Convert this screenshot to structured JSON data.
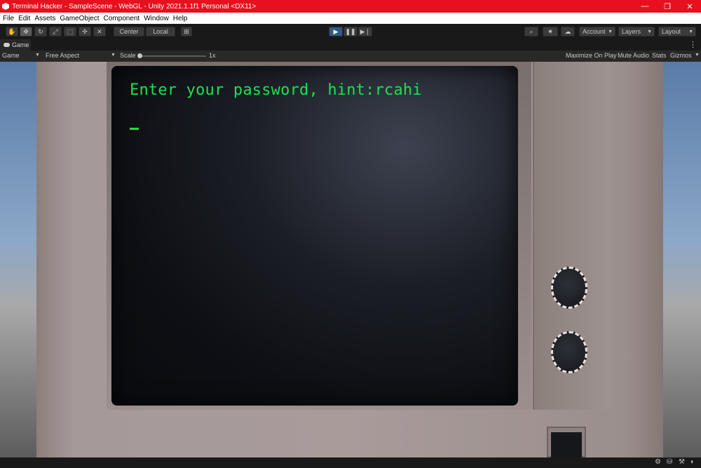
{
  "window": {
    "title": "Terminal Hacker - SampleScene - WebGL - Unity 2021.1.1f1 Personal <DX11>",
    "controls": {
      "minimize": "—",
      "restore": "❐",
      "close": "✕"
    }
  },
  "menu": [
    "File",
    "Edit",
    "Assets",
    "GameObject",
    "Component",
    "Window",
    "Help"
  ],
  "toolbar": {
    "tools": [
      {
        "name": "hand-tool",
        "glyph": "✋"
      },
      {
        "name": "move-tool",
        "glyph": "✥"
      },
      {
        "name": "rotate-tool",
        "glyph": "↻"
      },
      {
        "name": "scale-tool",
        "glyph": "⤢"
      },
      {
        "name": "rect-tool",
        "glyph": "⬚"
      },
      {
        "name": "transform-tool",
        "glyph": "✣"
      },
      {
        "name": "custom-tool",
        "glyph": "✕"
      }
    ],
    "pivot_label": "Center",
    "space_label": "Local",
    "snap_glyph": "⊞",
    "play_glyph": "▶",
    "pause_glyph": "❚❚",
    "step_glyph": "▶❘",
    "search_glyph": "⌕",
    "services_glyph": "✷",
    "cloud_glyph": "☁",
    "account_label": "Account",
    "layers_label": "Layers",
    "layout_label": "Layout",
    "accent_color": "#2f5b86"
  },
  "tabs": {
    "game": "Game",
    "more_glyph": "⋮"
  },
  "gamebar": {
    "display": "Game",
    "aspect": "Free Aspect",
    "scale_label": "Scale",
    "scale_value": "1x",
    "maximize": "Maximize On Play",
    "mute": "Mute Audio",
    "stats": "Stats",
    "gizmos": "Gizmos"
  },
  "terminal": {
    "prompt": "Enter your password, hint:rcahi",
    "text_color": "#19e34c"
  },
  "statusbar": {
    "icons": [
      "⚙",
      "⛁",
      "⚒",
      "◐"
    ]
  }
}
